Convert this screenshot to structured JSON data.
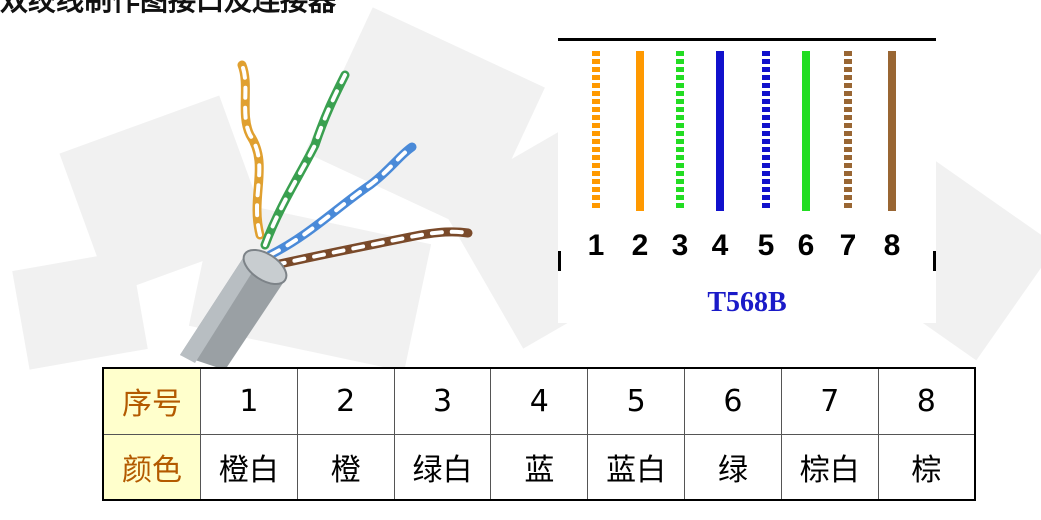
{
  "title": "双绞线制作图接口及连接器",
  "diagram": {
    "standard": "T568B",
    "pins": [
      {
        "number": "1",
        "color": "#ff9900",
        "striped": true
      },
      {
        "number": "2",
        "color": "#ff9900",
        "striped": false
      },
      {
        "number": "3",
        "color": "#22dd22",
        "striped": true
      },
      {
        "number": "4",
        "color": "#1111cc",
        "striped": false
      },
      {
        "number": "5",
        "color": "#1111cc",
        "striped": true
      },
      {
        "number": "6",
        "color": "#22dd22",
        "striped": false
      },
      {
        "number": "7",
        "color": "#996633",
        "striped": true
      },
      {
        "number": "8",
        "color": "#996633",
        "striped": false
      }
    ]
  },
  "table": {
    "row1_header": "序号",
    "row2_header": "颜色",
    "numbers": [
      "1",
      "2",
      "3",
      "4",
      "5",
      "6",
      "7",
      "8"
    ],
    "colors": [
      "橙白",
      "橙",
      "绿白",
      "蓝",
      "蓝白",
      "绿",
      "棕白",
      "棕"
    ]
  }
}
